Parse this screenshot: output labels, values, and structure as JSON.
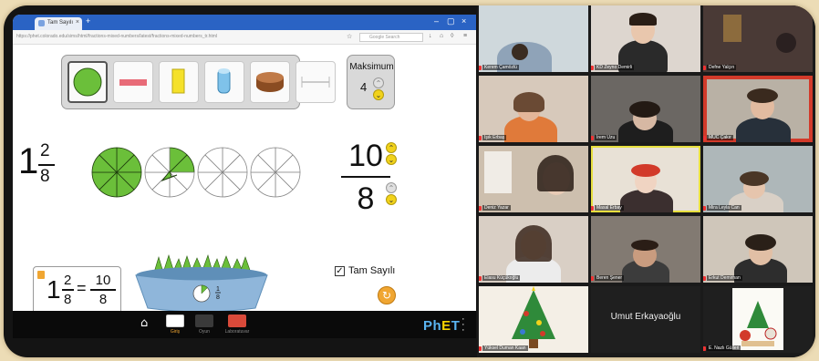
{
  "browser": {
    "tab_title": "Tam Sayılı",
    "url": "https://phet.colorado.edu/sims/html/fractions-mixed-numbers/latest/fractions-mixed-numbers_tr.html",
    "search_placeholder": "Google Search"
  },
  "sim": {
    "shapes": [
      "circle",
      "rectangle",
      "bar",
      "cylinder",
      "cake",
      "number-line"
    ],
    "selected_shape": "circle",
    "maximum": {
      "label": "Maksimum",
      "value": "4"
    },
    "mixed_number": {
      "whole": "1",
      "numerator": "2",
      "denominator": "8"
    },
    "improper_fraction": {
      "numerator": "10",
      "denominator": "8"
    },
    "pieces_filled": 10,
    "pieces_per_whole": 8,
    "equation": {
      "whole": "1",
      "numerator": "2",
      "denominator": "8",
      "equals": "=",
      "improper_numerator": "10",
      "improper_denominator": "8"
    },
    "bucket_piece": {
      "numerator": "1",
      "denominator": "8"
    },
    "mixed_checkbox": {
      "label": "Tam Sayılı",
      "checked": true
    }
  },
  "navbar": {
    "items": [
      "Giriş",
      "Oyun",
      "Laboratuvar"
    ],
    "brand": "PhET"
  },
  "participants": [
    "Kerem Çamözlü",
    "KD Zeyno Demirli",
    "Defne Yalçın",
    "Işık Erbaş",
    "İrem Uzu",
    "MUC Çakır",
    "Deniz Yazar",
    "Masal Erbay",
    "Mira Leyla Can",
    "Elasu Küçükoğlu",
    "Beren Şener",
    "Erkut Demirhan",
    "Yüksel Duman Kaan",
    "Umut Erkayaoğlu",
    "E. Nazlı Gülleri"
  ],
  "colors": {
    "fill_green": "#6bbf3a",
    "spinner_yellow": "#f1d21b",
    "active_speaker": "#e7df3e",
    "tab_bar": "#2a63c4"
  }
}
